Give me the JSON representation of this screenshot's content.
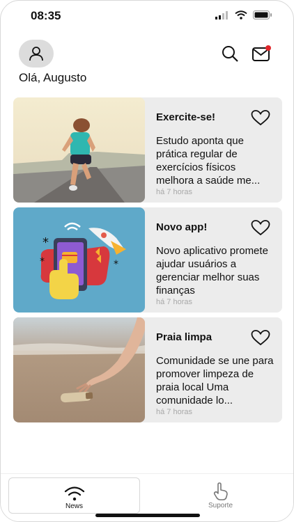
{
  "status_bar": {
    "time": "08:35"
  },
  "header": {
    "greeting": "Olá, Augusto"
  },
  "colors": {
    "notification_dot": "#e0262a",
    "card_bg": "#ececec",
    "muted": "#a8a8a8"
  },
  "news": [
    {
      "title": "Exercite-se!",
      "description": "Estudo aponta que prática regular de exercícios físicos melhora a saúde me...",
      "time": "há 7 horas",
      "image": "runner-photo"
    },
    {
      "title": "Novo app!",
      "description": "Novo aplicativo promete ajudar usuários a gerenciar melhor suas finanças",
      "time": "há 7 horas",
      "image": "phone-rocket-illustration"
    },
    {
      "title": "Praia limpa",
      "description": "Comunidade se une para promover limpeza de praia local Uma comunidade lo...",
      "time": "há 7 horas",
      "image": "beach-bottle-photo"
    }
  ],
  "tabbar": {
    "tabs": [
      {
        "label": "News",
        "icon": "wifi-icon",
        "selected": true
      },
      {
        "label": "Suporte",
        "icon": "hand-pointer-icon",
        "selected": false
      }
    ]
  }
}
